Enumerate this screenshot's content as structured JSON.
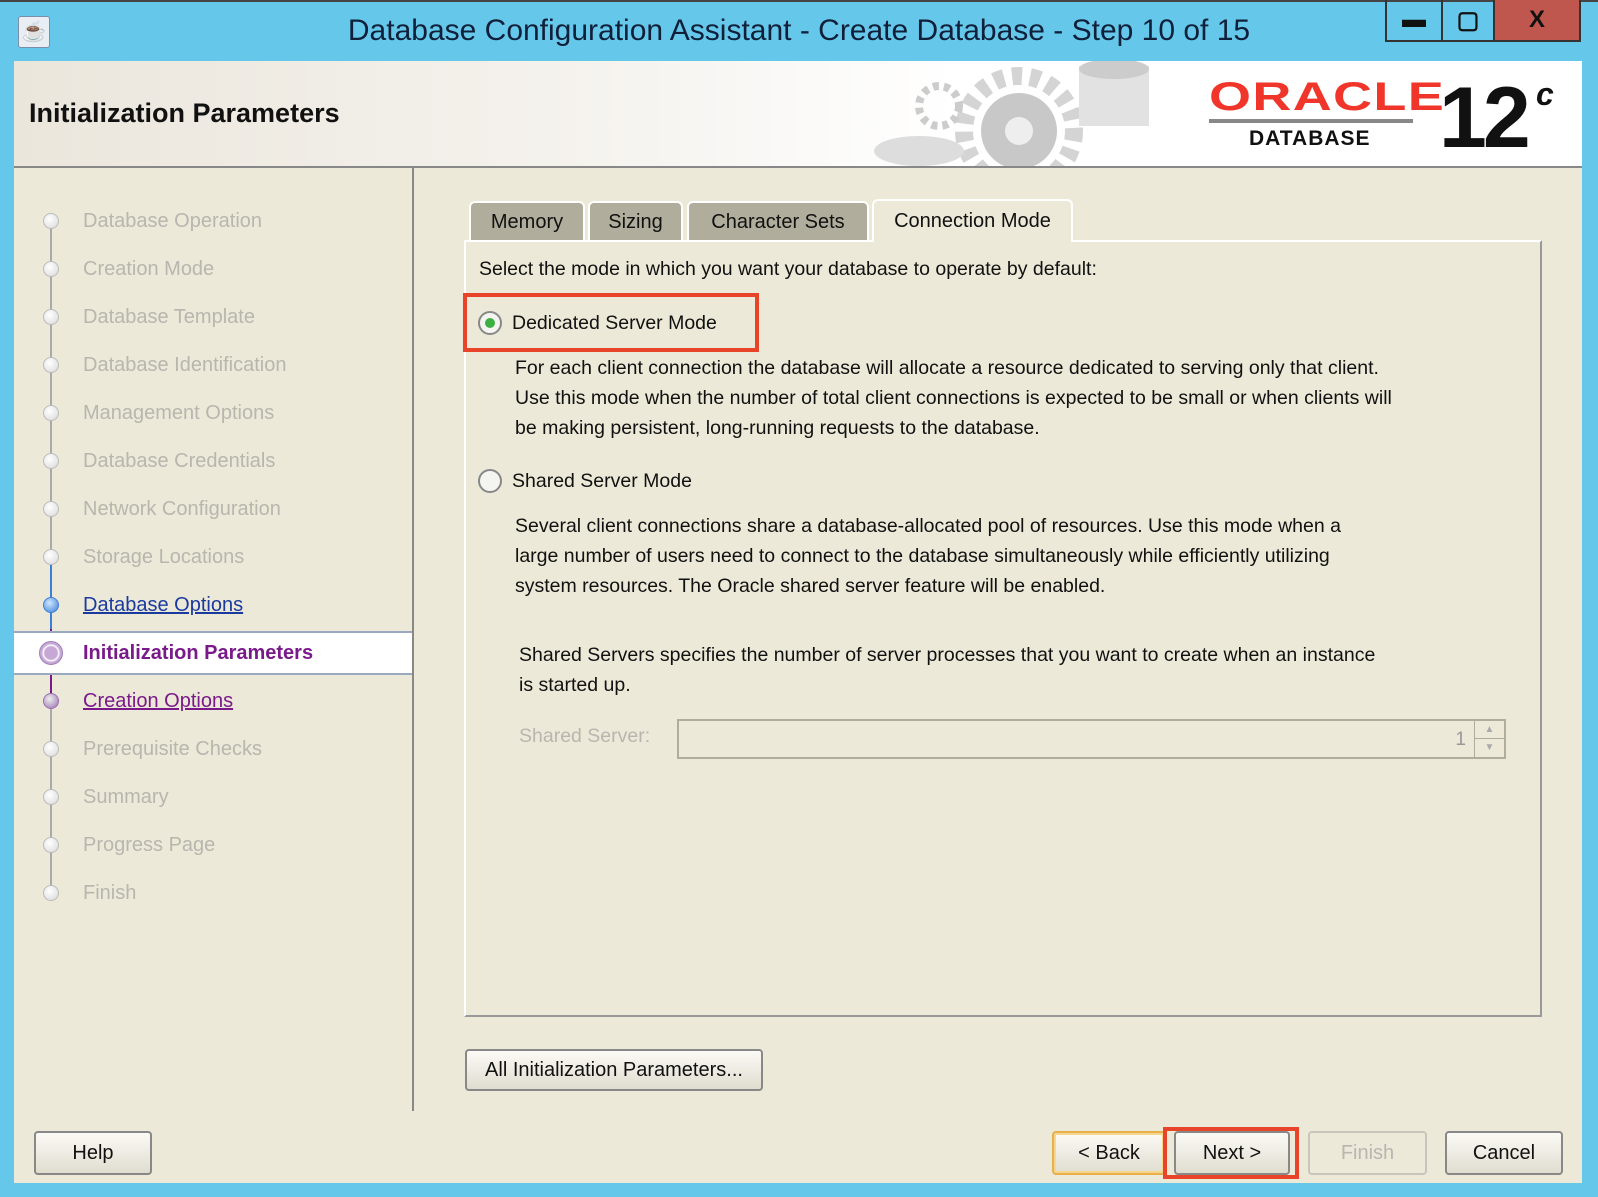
{
  "window": {
    "title": "Database Configuration Assistant - Create Database - Step 10 of 15",
    "controls": {
      "minimize": "▬",
      "maximize": "▢",
      "close": "X"
    }
  },
  "header": {
    "title": "Initialization Parameters",
    "logo": {
      "brand": "ORACLE",
      "product": "DATABASE",
      "version": "12",
      "version_suffix": "c"
    }
  },
  "steps": [
    {
      "label": "Database Operation",
      "state": "disabled"
    },
    {
      "label": "Creation Mode",
      "state": "disabled"
    },
    {
      "label": "Database Template",
      "state": "disabled"
    },
    {
      "label": "Database Identification",
      "state": "disabled"
    },
    {
      "label": "Management Options",
      "state": "disabled"
    },
    {
      "label": "Database Credentials",
      "state": "disabled"
    },
    {
      "label": "Network Configuration",
      "state": "disabled"
    },
    {
      "label": "Storage Locations",
      "state": "disabled"
    },
    {
      "label": "Database Options",
      "state": "done"
    },
    {
      "label": "Initialization Parameters",
      "state": "current"
    },
    {
      "label": "Creation Options",
      "state": "next"
    },
    {
      "label": "Prerequisite Checks",
      "state": "disabled"
    },
    {
      "label": "Summary",
      "state": "disabled"
    },
    {
      "label": "Progress Page",
      "state": "disabled"
    },
    {
      "label": "Finish",
      "state": "disabled"
    }
  ],
  "tabs": [
    {
      "label": "Memory",
      "active": false
    },
    {
      "label": "Sizing",
      "active": false
    },
    {
      "label": "Character Sets",
      "active": false
    },
    {
      "label": "Connection Mode",
      "active": true
    }
  ],
  "connection_mode": {
    "prompt": "Select the mode in which you want your database to operate by default:",
    "dedicated": {
      "label": "Dedicated Server Mode",
      "selected": true,
      "description": [
        "For each client connection the database will allocate a resource dedicated to serving only that client.",
        "Use this mode when the number of total client connections is expected to be small or when clients will",
        "be making persistent, long-running requests to the database."
      ]
    },
    "shared": {
      "label": "Shared Server Mode",
      "selected": false,
      "description": [
        "Several client connections share a database-allocated pool of resources.  Use this mode when a",
        "large number of users need to connect to the database simultaneously while efficiently utilizing",
        "system resources.  The Oracle shared server feature will be enabled."
      ]
    },
    "shared_servers_help": [
      "Shared Servers specifies the number of server processes that you want to create when an instance",
      "is started up."
    ],
    "shared_server_label": "Shared Server:",
    "shared_server_value": "1"
  },
  "buttons": {
    "all_params": "All Initialization Parameters...",
    "help": "Help",
    "back": "< Back",
    "next": "Next >",
    "finish": "Finish",
    "cancel": "Cancel"
  },
  "colors": {
    "titlebar": "#65c8ea",
    "highlight": "#e8442a",
    "oracle_red": "#f0352a"
  }
}
